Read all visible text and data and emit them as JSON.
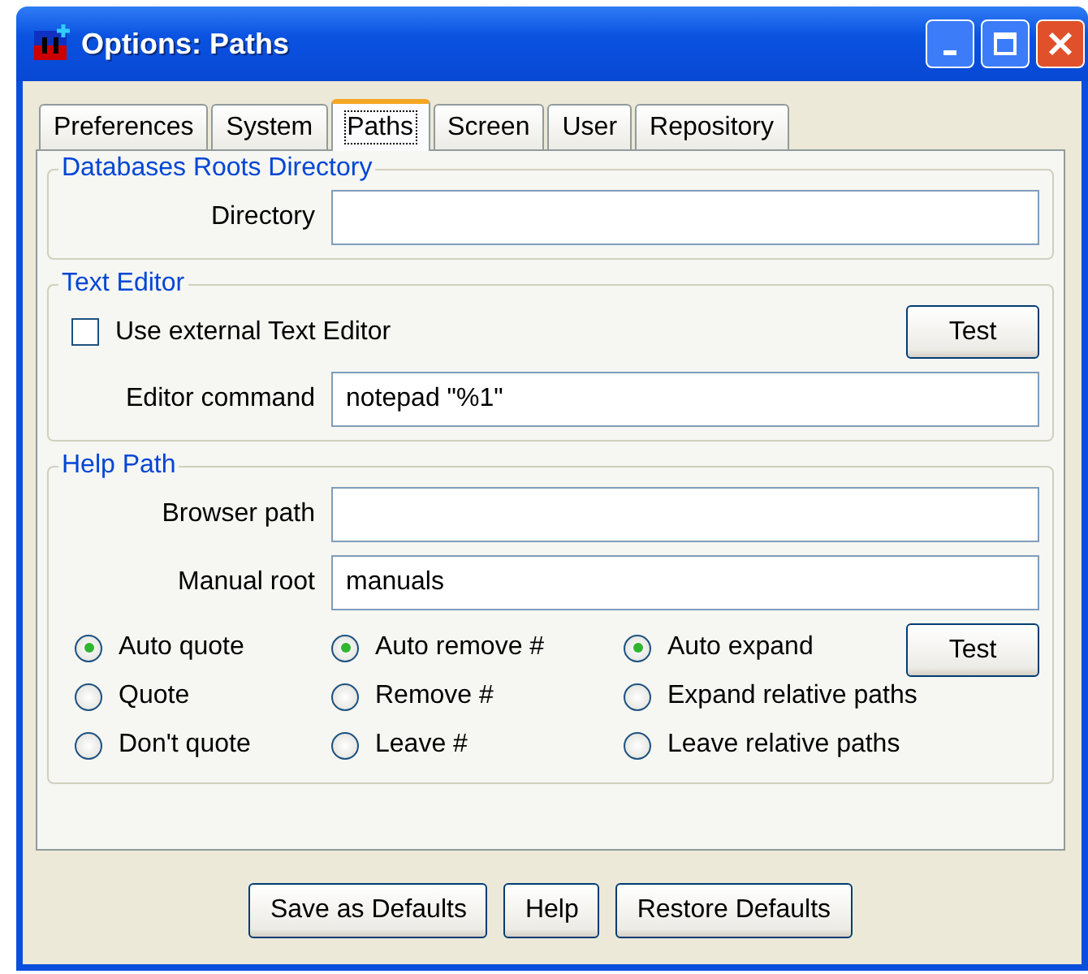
{
  "window": {
    "title": "Options: Paths"
  },
  "tabs": [
    {
      "label": "Preferences",
      "selected": false
    },
    {
      "label": "System",
      "selected": false
    },
    {
      "label": "Paths",
      "selected": true
    },
    {
      "label": "Screen",
      "selected": false
    },
    {
      "label": "User",
      "selected": false
    },
    {
      "label": "Repository",
      "selected": false
    }
  ],
  "databases_group": {
    "title": "Databases Roots Directory",
    "directory": {
      "label": "Directory"
    }
  },
  "text_editor_group": {
    "title": "Text Editor",
    "use_external": {
      "label": "Use external Text Editor",
      "checked": false
    },
    "test_button": "Test",
    "editor_command": {
      "label": "Editor command",
      "value": "notepad \"%1\""
    }
  },
  "help_path_group": {
    "title": "Help Path",
    "browser_path": {
      "label": "Browser path"
    },
    "manual_root": {
      "label": "Manual root",
      "value": "manuals"
    },
    "test_button": "Test",
    "radio_groups": [
      {
        "options": [
          {
            "label": "Auto quote",
            "selected": true
          },
          {
            "label": "Quote",
            "selected": false
          },
          {
            "label": "Don't quote",
            "selected": false
          }
        ]
      },
      {
        "options": [
          {
            "label": "Auto remove #",
            "selected": true
          },
          {
            "label": "Remove #",
            "selected": false
          },
          {
            "label": "Leave #",
            "selected": false
          }
        ]
      },
      {
        "options": [
          {
            "label": "Auto expand",
            "selected": true
          },
          {
            "label": "Expand relative paths",
            "selected": false
          },
          {
            "label": "Leave relative paths",
            "selected": false
          }
        ]
      }
    ]
  },
  "buttons": [
    "Save as Defaults",
    "Help",
    "Restore Defaults"
  ]
}
